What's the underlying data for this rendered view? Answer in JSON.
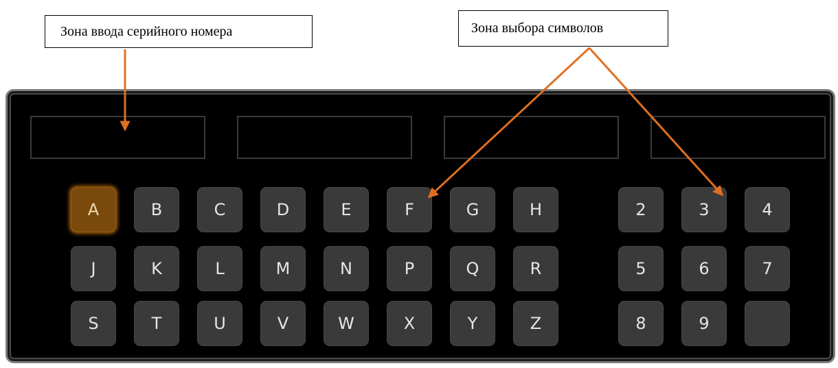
{
  "callouts": {
    "serial_input_zone": "Зона ввода серийного номера",
    "symbol_select_zone": "Зона выбора символов"
  },
  "serial_fields": [
    "",
    "",
    "",
    ""
  ],
  "letters": {
    "row1": [
      "A",
      "B",
      "C",
      "D",
      "E",
      "F",
      "G",
      "H"
    ],
    "row2": [
      "J",
      "K",
      "L",
      "M",
      "N",
      "P",
      "Q",
      "R"
    ],
    "row3": [
      "S",
      "T",
      "U",
      "V",
      "W",
      "X",
      "Y",
      "Z"
    ]
  },
  "digits": {
    "row1": [
      "2",
      "3",
      "4"
    ],
    "row2": [
      "5",
      "6",
      "7"
    ],
    "row3": [
      "8",
      "9",
      ""
    ]
  },
  "selected_key": "A",
  "colors": {
    "arrow": "#e07020",
    "panel_bg": "#000000",
    "key_bg": "#3a3a3a",
    "key_selected_bg": "#7a4a0c",
    "key_text": "#e6e6e6"
  }
}
